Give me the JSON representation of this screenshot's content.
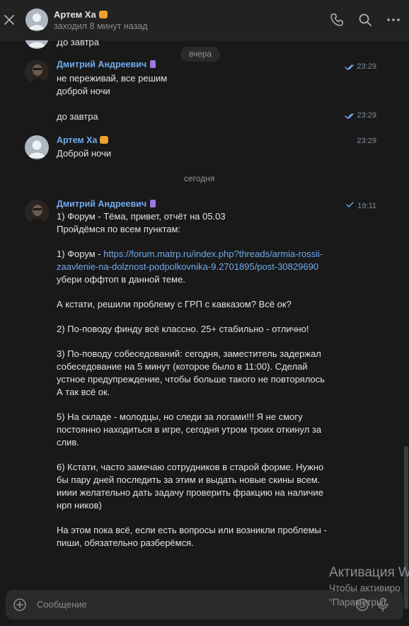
{
  "header": {
    "name": "Артем Ха",
    "status": "заходил 8 минут назад",
    "icons": [
      "close-icon",
      "phone-icon",
      "search-icon",
      "more-icon"
    ]
  },
  "messages": {
    "prev_text": "До завтра",
    "date_yesterday": "вчера",
    "m1": {
      "sender": "Дмитрий Андреевич",
      "line1": "не переживай, все решим",
      "line2": "доброй ночи",
      "time": "23:29"
    },
    "m2": {
      "text": "до завтра",
      "time": "23:29"
    },
    "m3": {
      "sender": "Артем Ха",
      "text": "Доброй ночи",
      "time": "23:29"
    },
    "date_today": "сегодня",
    "m4": {
      "sender": "Дмитрий Андреевич",
      "time": "19:11",
      "lines": [
        "1) Форум - Тёма, привет, отчёт на 05.03",
        "Пройдёмся по всем пунктам:",
        "",
        "1) Форум - ",
        "https://forum.matrp.ru/index.php?threads/armia-rossii-",
        "zaavlenie-na-dolznost-podpolkovnika-9.2701895/post-30829690",
        "убери оффтоп в данной теме.",
        "",
        "А кстати, решили проблему с ГРП с кавказом? Всё ок?",
        "",
        "2) По-поводу финду всё классно. 25+ стабильно - отлично!",
        "",
        "3) По-поводу собеседований: сегодня, заместитель задержал",
        "собеседование на 5 минут (которое было в 11:00). Сделай",
        "устное предупреждение, чтобы больше такого не повторялось",
        "А так всё ок.",
        "",
        "5) На складе - молодцы, но следи за логами!!! Я не смогу",
        "постоянно находиться в игре, сегодня утром троих откинул за",
        "слив.",
        "",
        "6) Кстати, часто замечаю сотрудников в старой форме. Нужно",
        "бы пару дней последить за этим и выдать новые скины всем.",
        "ииии желательно дать задачу проверить фракцию на наличие",
        "нрп ников)",
        "",
        "На этом пока всё, если есть вопросы или возникли проблемы -",
        "пиши, обязательно разберёмся."
      ]
    }
  },
  "composer": {
    "placeholder": "Сообщение"
  },
  "watermark": {
    "title": "Активация W",
    "line1": "Чтобы активиро",
    "line2": "\"Параметры\"."
  },
  "colors": {
    "background": "#19191a",
    "link": "#71aaeb",
    "read_check": "#71aaeb"
  }
}
